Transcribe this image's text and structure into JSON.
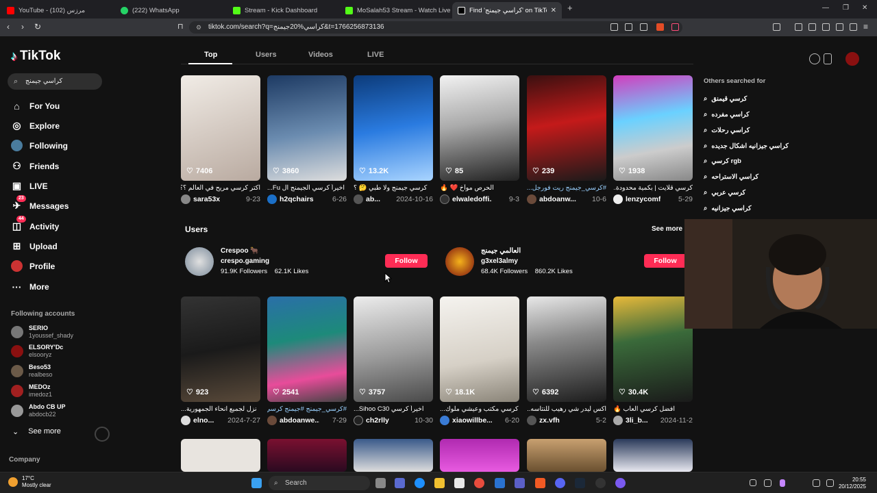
{
  "browser": {
    "tabs": [
      {
        "label": "YouTube - مرزس (102)",
        "color": "#ff0000"
      },
      {
        "label": "(222) WhatsApp",
        "color": "#25d366"
      },
      {
        "label": "Stream - Kick Dashboard",
        "color": "#53fc18"
      },
      {
        "label": "MoSalah53 Stream - Watch Live on Kick",
        "color": "#53fc18"
      },
      {
        "label": "Find 'كراسي جيمنج' on TikTok | Tik",
        "color": "#ffffff"
      }
    ],
    "url": "tiktok.com/search?q=كراسي%20جيمنج&t=1766256873136"
  },
  "tiktok": {
    "logo": "TikTok",
    "search_value": "كراسي جيمنج",
    "nav": [
      {
        "label": "For You",
        "icon": "home-icon"
      },
      {
        "label": "Explore",
        "icon": "compass-icon"
      },
      {
        "label": "Following",
        "icon": "following-icon"
      },
      {
        "label": "Friends",
        "icon": "friends-icon"
      },
      {
        "label": "LIVE",
        "icon": "live-icon"
      },
      {
        "label": "Messages",
        "icon": "messages-icon",
        "badge": "23"
      },
      {
        "label": "Activity",
        "icon": "activity-icon",
        "badge": "44"
      },
      {
        "label": "Upload",
        "icon": "upload-icon"
      },
      {
        "label": "Profile",
        "icon": "profile-icon"
      },
      {
        "label": "More",
        "icon": "more-icon"
      }
    ],
    "following_title": "Following accounts",
    "following": [
      {
        "name": "SERIO",
        "handle": "1youssef_shady"
      },
      {
        "name": "ELSORY'Dc",
        "handle": "elsooryz"
      },
      {
        "name": "Beso53",
        "handle": "realbeso"
      },
      {
        "name": "MEDOz",
        "handle": "imedoz1"
      },
      {
        "name": "Abdo CB UP",
        "handle": "abdocb22"
      }
    ],
    "see_more": "See more",
    "company": "Company",
    "tabs": [
      "Top",
      "Users",
      "Videos",
      "LIVE"
    ],
    "row1": [
      {
        "likes": "7406",
        "caption": "اكتر كرسي مريح في العالم ؟؟",
        "user": "sara53x",
        "date": "9-23"
      },
      {
        "likes": "3860",
        "caption": "اخيراً كرسي الجيمنج ال Fu...",
        "user": "h2qchairs",
        "date": "6-26"
      },
      {
        "likes": "13.2K",
        "caption": "كرسي جيمنج ولا طبي 🤔 ؟",
        "user": "ab...",
        "date": "2024-10-16"
      },
      {
        "likes": "85",
        "caption": "الحرص موآخ ❤️ 🔥",
        "user": "elwaledoffi...",
        "date": "9-3"
      },
      {
        "likes": "239",
        "caption": "#كرسي_جيمنج ريت فورجل...",
        "user": "abdoanw...",
        "date": "10-6"
      },
      {
        "likes": "1938",
        "caption": "كرسي قلايت | بكمية محدودة...",
        "user": "lenzycomf",
        "date": "5-29"
      }
    ],
    "users_title": "Users",
    "users_see_more": "See more",
    "users": [
      {
        "name": "Crespoo 🐂",
        "handle": "crespo.gaming",
        "followers": "91.9K Followers",
        "likes": "62.1K Likes",
        "follow": "Follow"
      },
      {
        "name": "العالمي جيمنج",
        "handle": "g3xel3almy",
        "followers": "68.4K Followers",
        "likes": "860.2K Likes",
        "follow": "Follow"
      }
    ],
    "row2": [
      {
        "likes": "923",
        "caption": "نزل لجميع انحاء الجمهورية...",
        "user": "elno...",
        "date": "2024-7-27"
      },
      {
        "likes": "2541",
        "caption": "#كرسي_جيمنج #جيمنج كرسي بلال...",
        "user": "abdoanwe...",
        "date": "7-29"
      },
      {
        "likes": "3757",
        "caption": "اخيراً كرسي Sihoo C30...",
        "user": "ch2rlly",
        "date": "10-30"
      },
      {
        "likes": "18.1K",
        "caption": "كرسي مكتب وعيشي ملوك...",
        "user": "xiaowillbe...",
        "date": "6-20"
      },
      {
        "likes": "6392",
        "caption": "اكس ليدر شي رهيب للنتاسه...",
        "user": "zx.vfh",
        "date": "5-2"
      },
      {
        "likes": "30.4K",
        "caption": "افضل كرسي العاب 🔥",
        "user": "3li_b...",
        "date": "2024-11-2"
      }
    ],
    "others_title": "Others searched for",
    "others": [
      "كرسي قيمنق",
      "كراسي مفرده",
      "كراسي رحلات",
      "كراسي جيزانيه اشكال جديده",
      "كرسي rgb",
      "كراسي الاستراحه",
      "كرسي عربي",
      "كراسي جيزانيه"
    ]
  },
  "taskbar": {
    "temp": "17°C",
    "weather": "Mostly clear",
    "search": "Search",
    "time": "20:55",
    "date": "20/12/2025"
  },
  "colors": {
    "accent": "#fe2c55",
    "bg": "#121212"
  }
}
